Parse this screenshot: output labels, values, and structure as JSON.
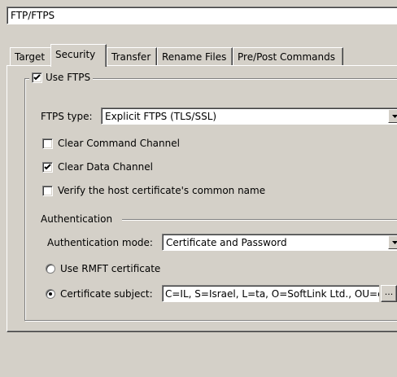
{
  "window": {
    "title_field_value": "FTP/FTPS"
  },
  "tabs": [
    {
      "label": "Target"
    },
    {
      "label": "Security",
      "active": true
    },
    {
      "label": "Transfer"
    },
    {
      "label": "Rename Files"
    },
    {
      "label": "Pre/Post Commands"
    }
  ],
  "security": {
    "use_ftps_label": "Use FTPS",
    "use_ftps_checked": true,
    "ftps_type_label": "FTPS type:",
    "ftps_type_value": "Explicit FTPS (TLS/SSL)",
    "clear_command_label": "Clear Command Channel",
    "clear_command_checked": false,
    "clear_data_label": "Clear Data Channel",
    "clear_data_checked": true,
    "verify_host_label": "Verify the host certificate's common name",
    "verify_host_checked": false
  },
  "authentication": {
    "section_label": "Authentication",
    "mode_label": "Authentication mode:",
    "mode_value": "Certificate and Password",
    "rmft_label": "Use RMFT certificate",
    "rmft_selected": false,
    "subject_label": "Certificate subject:",
    "subject_selected": true,
    "subject_value": "C=IL, S=Israel, L=ta, O=SoftLink Ltd., OU=c",
    "browse_label": "..."
  }
}
